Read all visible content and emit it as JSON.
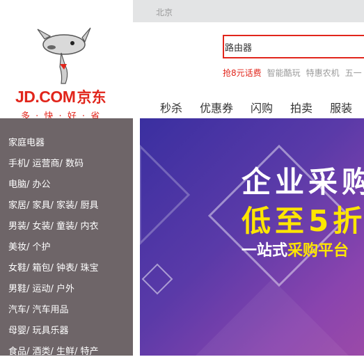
{
  "header": {
    "city": "北京"
  },
  "logo": {
    "text_en": "JD.COM",
    "text_cn": "京东",
    "slogan": "多 · 快 · 好 · 省"
  },
  "search": {
    "value": "路由器"
  },
  "hotwords": [
    {
      "label": "抢8元话费",
      "hot": true
    },
    {
      "label": "智能酷玩",
      "hot": false
    },
    {
      "label": "特惠农机",
      "hot": false
    },
    {
      "label": "五一",
      "hot": false
    }
  ],
  "navs": [
    "秒杀",
    "优惠券",
    "闪购",
    "拍卖",
    "服装"
  ],
  "categories": [
    "家庭电器",
    "手机/ 运营商/ 数码",
    "电脑/ 办公",
    "家居/ 家具/ 家装/ 厨具",
    "男装/ 女装/ 童装/ 内衣",
    "美妆/ 个护",
    "女鞋/ 箱包/ 钟表/ 珠宝",
    "男鞋/ 运动/ 户外",
    "汽车/ 汽车用品",
    "母婴/ 玩具乐器",
    "食品/ 酒类/ 生鲜/ 特产"
  ],
  "banner": {
    "line1": "企业采购",
    "line2": "低至5折",
    "line3_white": "一站式",
    "line3_yellow": "采购平台"
  },
  "colors": {
    "brand": "#e1251b",
    "sidebar": "#6e6568",
    "accent_yellow": "#ffe600"
  }
}
